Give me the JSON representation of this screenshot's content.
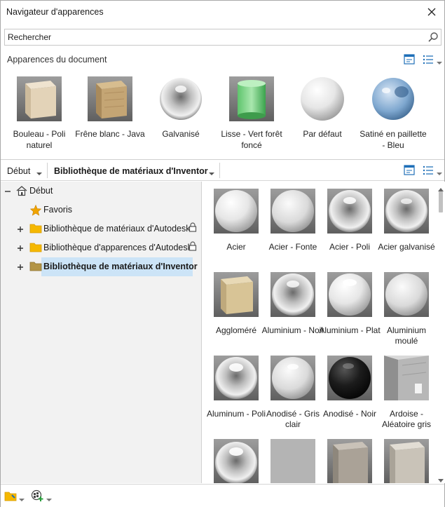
{
  "window": {
    "title": "Navigateur d'apparences",
    "close_icon": "close-icon"
  },
  "search": {
    "value": "Rechercher",
    "icon": "search-icon"
  },
  "document": {
    "header": "Apparences du document",
    "items": [
      {
        "label": "Bouleau - Poli naturel"
      },
      {
        "label": "Frêne blanc - Java"
      },
      {
        "label": "Galvanisé"
      },
      {
        "label": "Lisse - Vert forêt foncé"
      },
      {
        "label": "Par défaut"
      },
      {
        "label": "Satiné en paillette - Bleu"
      }
    ]
  },
  "crumbs": {
    "root": "Début",
    "library": "Bibliothèque de matériaux d'Inventor"
  },
  "tree": {
    "root": "Début",
    "favorites": "Favoris",
    "items": [
      {
        "label": "Bibliothèque de matériaux d'Autodesk",
        "locked": true
      },
      {
        "label": "Bibliothèque d'apparences d'Autodesk",
        "locked": true
      },
      {
        "label": "Bibliothèque de matériaux d'Inventor",
        "locked": false,
        "selected": true
      }
    ]
  },
  "library": {
    "items": [
      {
        "label": "Acier"
      },
      {
        "label": "Acier - Fonte"
      },
      {
        "label": "Acier - Poli"
      },
      {
        "label": "Acier galvanisé"
      },
      {
        "label": "Aggloméré"
      },
      {
        "label": "Aluminium - Noir"
      },
      {
        "label": "Aluminium - Plat"
      },
      {
        "label": "Aluminium moulé"
      },
      {
        "label": "Aluminum - Poli"
      },
      {
        "label": "Anodisé - Gris clair"
      },
      {
        "label": "Anodisé - Noir"
      },
      {
        "label": "Ardoise - Aléatoire gris"
      }
    ]
  },
  "colors": {
    "selection": "#cce4f7",
    "folder": "#f5b800",
    "star": "#f0a400"
  }
}
